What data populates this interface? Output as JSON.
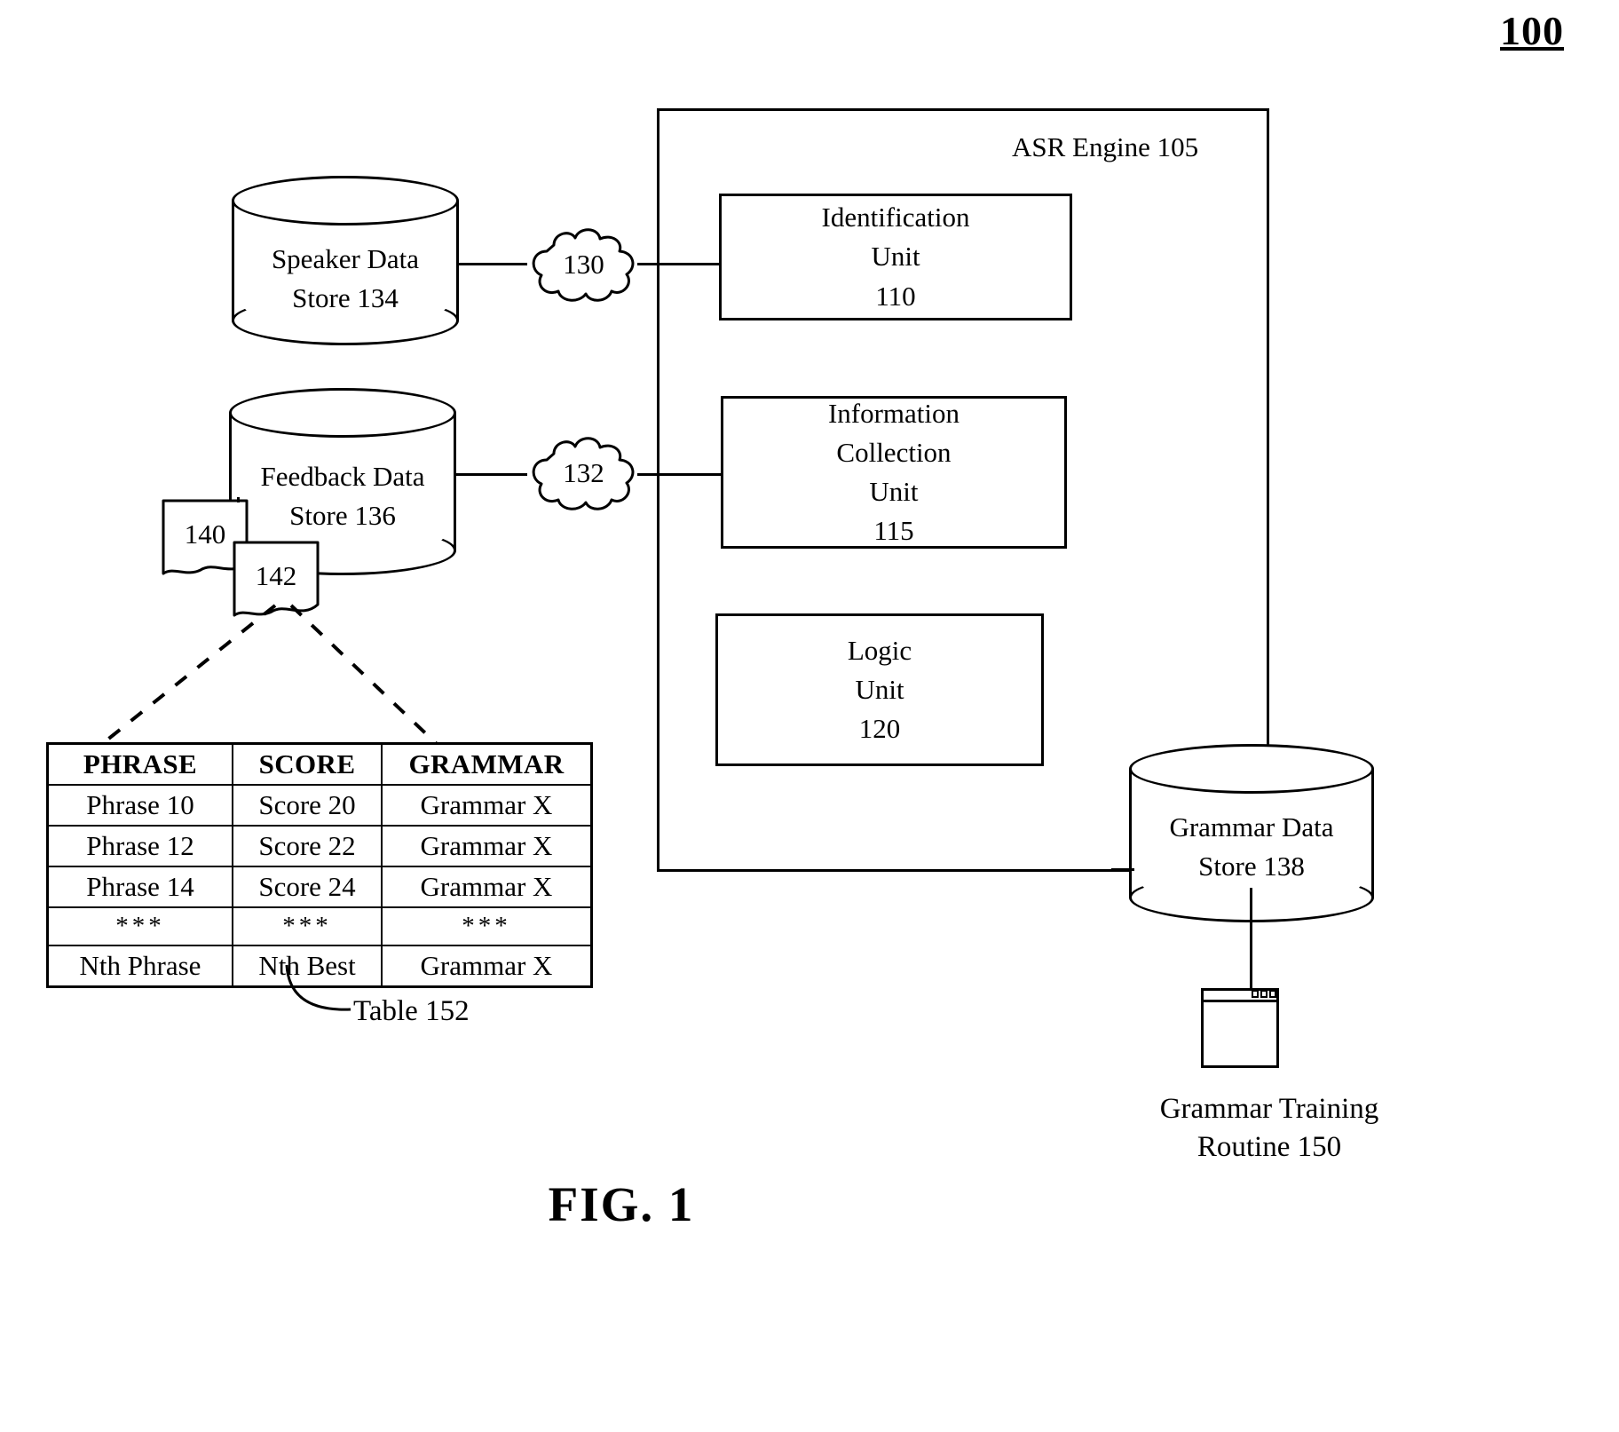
{
  "figure": {
    "number": "100",
    "caption": "FIG. 1"
  },
  "asr_engine": {
    "label": "ASR Engine 105",
    "units": [
      {
        "name": "identification-unit",
        "text": "Identification\nUnit\n110"
      },
      {
        "name": "information-collection-unit",
        "text": "Information\nCollection\nUnit\n115"
      },
      {
        "name": "logic-unit",
        "text": "Logic\nUnit\n120"
      }
    ]
  },
  "data_stores": [
    {
      "name": "speaker-data-store",
      "text": "Speaker Data\nStore 134"
    },
    {
      "name": "feedback-data-store",
      "text": "Feedback Data\nStore 136"
    },
    {
      "name": "grammar-data-store",
      "text": "Grammar Data\nStore 138"
    }
  ],
  "networks": [
    {
      "name": "network-cloud-130",
      "number": "130"
    },
    {
      "name": "network-cloud-132",
      "number": "132"
    }
  ],
  "document_tags": [
    {
      "name": "document-tag-140",
      "number": "140"
    },
    {
      "name": "document-tag-142",
      "number": "142"
    }
  ],
  "table": {
    "label": "Table 152",
    "headers": [
      "PHRASE",
      "SCORE",
      "GRAMMAR"
    ],
    "rows": [
      [
        "Phrase 10",
        "Score 20",
        "Grammar X"
      ],
      [
        "Phrase 12",
        "Score 22",
        "Grammar X"
      ],
      [
        "Phrase 14",
        "Score 24",
        "Grammar X"
      ],
      [
        "***",
        "***",
        "***"
      ],
      [
        "Nth Phrase",
        "Nth Best",
        "Grammar X"
      ]
    ]
  },
  "training_routine": {
    "label": "Grammar Training\nRoutine 150"
  },
  "colors": {
    "stroke": "#000000",
    "background": "#ffffff"
  }
}
